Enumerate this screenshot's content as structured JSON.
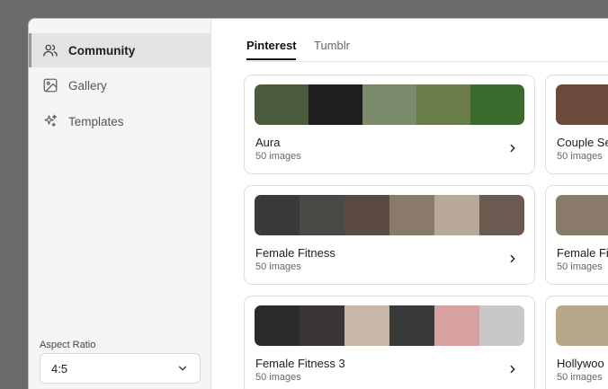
{
  "sidebar": {
    "items": [
      {
        "label": "Community",
        "icon": "users-icon"
      },
      {
        "label": "Gallery",
        "icon": "image-icon"
      },
      {
        "label": "Templates",
        "icon": "sparkles-icon"
      }
    ],
    "aspect_ratio_label": "Aspect Ratio",
    "aspect_ratio_value": "4:5"
  },
  "tabs": [
    {
      "label": "Pinterest",
      "active": true
    },
    {
      "label": "Tumblr",
      "active": false
    }
  ],
  "collections": [
    {
      "title": "Aura",
      "count": "50 images",
      "colors": [
        "#4a5a3c",
        "#1e1e1e",
        "#7a8a6a",
        "#6a7d4a",
        "#3a6a2e"
      ]
    },
    {
      "title": "Couple Se",
      "count": "50 images",
      "colors": [
        "#6a4a3a"
      ]
    },
    {
      "title": "Female Fitness",
      "count": "50 images",
      "colors": [
        "#3a3a3a",
        "#4a4a44",
        "#5a4a40",
        "#8a7a6a",
        "#b8a898",
        "#6a5a50"
      ]
    },
    {
      "title": "Female Fit",
      "count": "50 images",
      "colors": [
        "#8a7a6a"
      ]
    },
    {
      "title": "Female Fitness 3",
      "count": "50 images",
      "colors": [
        "#2a2a2a",
        "#3a3434",
        "#c8b8a8",
        "#3a3a3a",
        "#d8a0a0",
        "#c8c8c8"
      ]
    },
    {
      "title": "Hollywoo",
      "count": "50 images",
      "colors": [
        "#b8a88a"
      ]
    }
  ]
}
